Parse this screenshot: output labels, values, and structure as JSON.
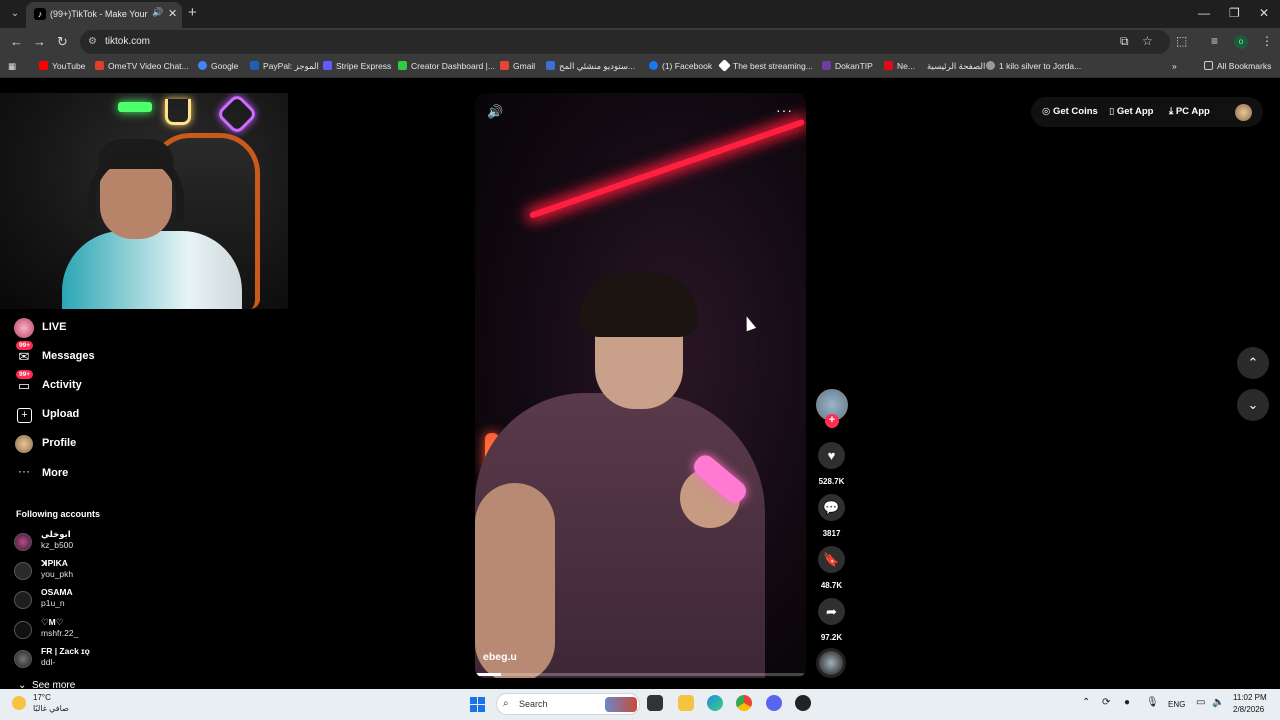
{
  "browser": {
    "tab_title": "(99+)TikTok - Make Your Day",
    "tab_audio_icon": "speaker-icon",
    "url": "tiktok.com",
    "bookmarks": [
      {
        "label": "YouTube",
        "color": "#ff0000"
      },
      {
        "label": "OmeTV Video Chat...",
        "color": "#e0402a"
      },
      {
        "label": "Google",
        "color": "#4285f4"
      },
      {
        "label": "PayPal: الموجز",
        "color": "#1f5fb8"
      },
      {
        "label": "Stripe Express",
        "color": "#635bff"
      },
      {
        "label": "Creator Dashboard |...",
        "color": "#2ecc40"
      },
      {
        "label": "Gmail",
        "color": "#ea4335"
      },
      {
        "label": "ستوديو منشئي المح...",
        "color": "#3b6fd6"
      },
      {
        "label": "(1) Facebook",
        "color": "#1877f2"
      },
      {
        "label": "The best streaming...",
        "color": "#ffffff"
      },
      {
        "label": "DokanTIP",
        "color": "#6b3fa0"
      },
      {
        "label": "Ne...",
        "color": "#e50914"
      },
      {
        "label": "الصفحة الرئيسية",
        "color": "#888888"
      },
      {
        "label": "1 kilo silver to Jorda...",
        "color": "#999999"
      }
    ],
    "all_bookmarks": "All Bookmarks",
    "profile_initial": "o"
  },
  "sidebar": {
    "items": [
      {
        "label": "LIVE"
      },
      {
        "label": "Messages",
        "badge": "99+"
      },
      {
        "label": "Activity",
        "badge": "99+"
      },
      {
        "label": "Upload"
      },
      {
        "label": "Profile"
      },
      {
        "label": "More"
      }
    ],
    "following_title": "Following accounts",
    "accounts": [
      {
        "name": "ابوخلي",
        "username": "kz_b500"
      },
      {
        "name": "ꓘPIKA",
        "username": "you_pkh"
      },
      {
        "name": "OSAMA",
        "username": "p1u_n"
      },
      {
        "name": "♡M♡",
        "username": "mshfr.22_"
      },
      {
        "name": "FR | Zack ɪǫ",
        "username": "ddl-"
      }
    ],
    "see_more": "See more"
  },
  "video": {
    "author": "ebeg.u",
    "progress": 0.08,
    "likes": "528.7K",
    "comments": "3817",
    "saves": "48.7K",
    "shares": "97.2K"
  },
  "top_right": {
    "get_coins": "Get Coins",
    "get_app": "Get App",
    "pc_app": "PC App"
  },
  "taskbar": {
    "temp": "17°C",
    "weather": "صافي غالبًا",
    "search": "Search",
    "lang": "ENG",
    "time": "11:02 PM",
    "date": "2/8/2026"
  },
  "colors": {
    "accent": "#fe2c55",
    "background": "#000000"
  }
}
